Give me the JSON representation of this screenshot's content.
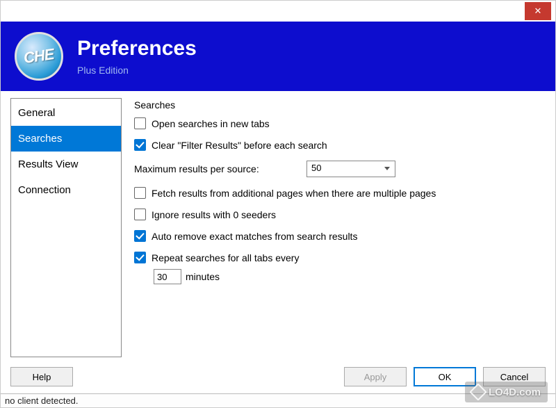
{
  "header": {
    "title": "Preferences",
    "subtitle": "Plus Edition",
    "logo_text": "CHE"
  },
  "nav": {
    "items": [
      {
        "label": "General"
      },
      {
        "label": "Searches"
      },
      {
        "label": "Results View"
      },
      {
        "label": "Connection"
      }
    ],
    "selected_index": 1
  },
  "content": {
    "section_title": "Searches",
    "open_new_tabs": {
      "label": "Open searches in new tabs",
      "checked": false
    },
    "clear_filter": {
      "label": "Clear \"Filter Results\" before each search",
      "checked": true
    },
    "max_results": {
      "label": "Maximum results per source:",
      "value": "50"
    },
    "fetch_additional": {
      "label": "Fetch results from additional pages when there are multiple pages",
      "checked": false
    },
    "ignore_zero": {
      "label": "Ignore results with 0 seeders",
      "checked": false
    },
    "auto_remove": {
      "label": "Auto remove exact matches from search results",
      "checked": true
    },
    "repeat": {
      "label": "Repeat searches for all tabs every",
      "checked": true,
      "value": "30",
      "unit": "minutes"
    }
  },
  "footer": {
    "help": "Help",
    "apply": "Apply",
    "ok": "OK",
    "cancel": "Cancel"
  },
  "statusbar": "no client detected.",
  "watermark": "LO4D.com"
}
